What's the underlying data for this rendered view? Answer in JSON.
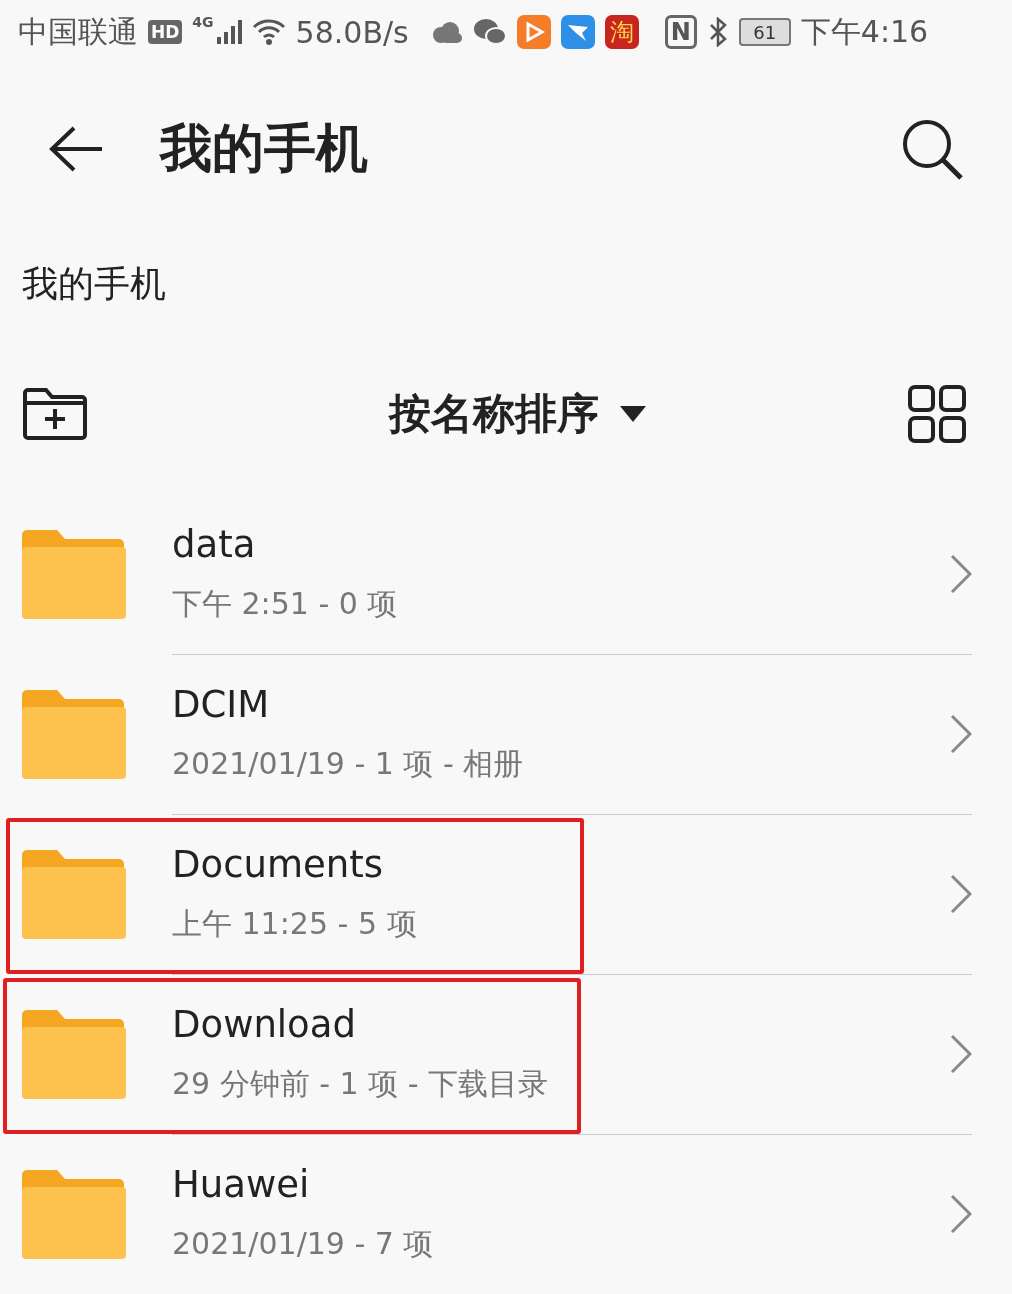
{
  "status_bar": {
    "carrier": "中国联通",
    "hd": "HD",
    "network": "4G",
    "speed": "58.0B/s",
    "taobao": "淘",
    "nfc": "N",
    "battery": "61",
    "time": "下午4:16"
  },
  "header": {
    "title": "我的手机"
  },
  "breadcrumb": "我的手机",
  "toolbar": {
    "sort": "按名称排序"
  },
  "rows": [
    {
      "name": "data",
      "meta": "下午 2:51  - 0 项",
      "highlighted": false
    },
    {
      "name": "DCIM",
      "meta": "2021/01/19 - 1 项 - 相册",
      "highlighted": false
    },
    {
      "name": "Documents",
      "meta": "上午 11:25  - 5 项",
      "highlighted": true
    },
    {
      "name": "Download",
      "meta": "29 分钟前 - 1 项 - 下载目录",
      "highlighted": true
    },
    {
      "name": "Huawei",
      "meta": "2021/01/19 - 7 项",
      "highlighted": false
    }
  ]
}
